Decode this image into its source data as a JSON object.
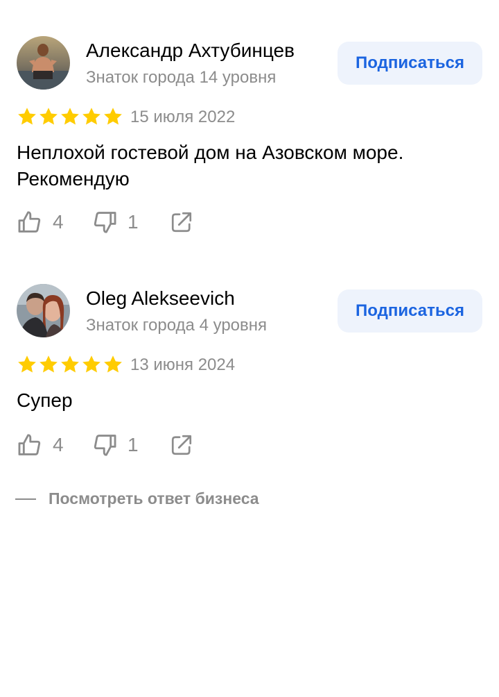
{
  "reviews": [
    {
      "author_name": "Александр Ахтубинцев",
      "author_level": "Знаток города 14 уровня",
      "subscribe_label": "Подписаться",
      "rating": 5,
      "date": "15 июля 2022",
      "text": "Неплохой гостевой дом на Азовском море. Рекомендую",
      "likes": "4",
      "dislikes": "1",
      "avatar_icon": "person-swimming-photo"
    },
    {
      "author_name": "Oleg Alekseevich",
      "author_level": "Знаток города 4 уровня",
      "subscribe_label": "Подписаться",
      "rating": 5,
      "date": "13 июня 2024",
      "text": "Супер",
      "likes": "4",
      "dislikes": "1",
      "avatar_icon": "couple-selfie-photo"
    }
  ],
  "business_reply": {
    "label": "Посмотреть ответ бизнеса"
  },
  "colors": {
    "star": "#fc0",
    "accent": "#1b64e0",
    "button_bg": "#eef3fc",
    "muted_text": "#8c8c8c"
  },
  "icons": {
    "like": "thumbs-up-icon",
    "dislike": "thumbs-down-icon",
    "share": "share-icon",
    "star": "star-icon"
  }
}
